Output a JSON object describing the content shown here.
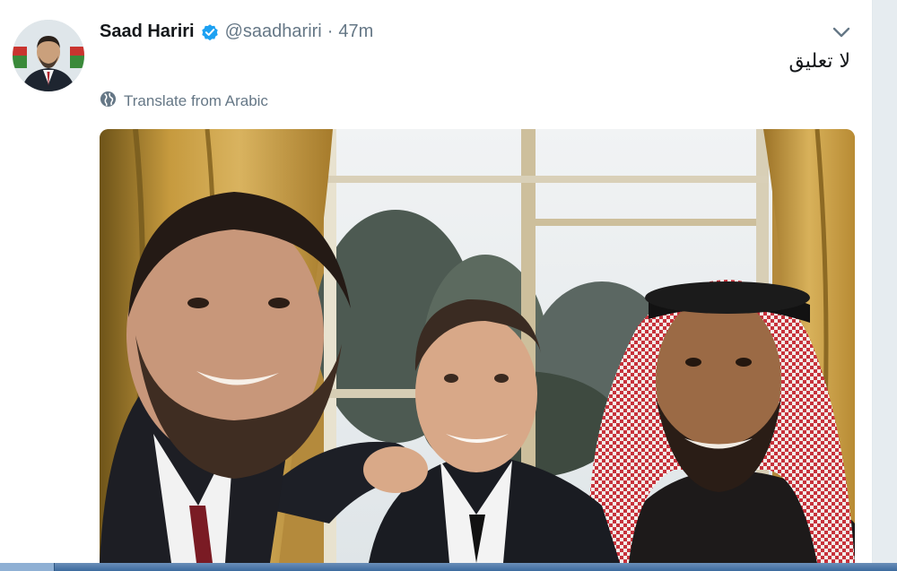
{
  "tweet": {
    "author_name": "Saad Hariri",
    "verified": true,
    "handle": "@saadhariri",
    "separator": "·",
    "time": "47m",
    "text": "لا تعليق",
    "translate_label": "Translate from Arabic"
  },
  "colors": {
    "verified_blue": "#1da1f2",
    "secondary_text": "#657786",
    "primary_text": "#14171a"
  },
  "icons": {
    "globe": "globe-icon",
    "chevron": "chevron-down-icon",
    "verified": "verified-badge-icon"
  }
}
